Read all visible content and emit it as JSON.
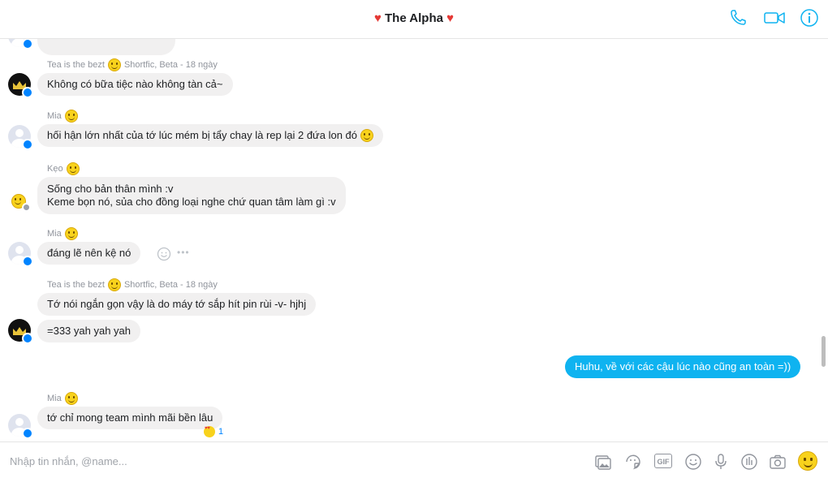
{
  "header": {
    "title": "The Alpha",
    "heart_left": "♥",
    "heart_right": "♥",
    "icons": [
      "phone-icon",
      "video-icon",
      "info-icon"
    ],
    "accent": "#0084ff"
  },
  "messages": [
    {
      "sender": "Tea is the bezt",
      "meta": "Shortfic, Beta - 18 ngày",
      "text": "Không có bữa tiệc nào không tàn cả~"
    },
    {
      "sender": "Mia",
      "text": "hối hận lớn nhất của tớ lúc mém bị tẩy chay là rep lại 2 đứa lon đó"
    },
    {
      "sender": "Kẹo",
      "line1": "Sống cho bản thân mình :v",
      "line2": "Keme bọn nó, sủa cho đồng loại nghe chứ quan tâm làm gì :v"
    },
    {
      "sender": "Mia",
      "text": "đáng lẽ nên kệ nó",
      "more": "•••"
    },
    {
      "sender": "Tea is the bezt",
      "meta": "Shortfic, Beta - 18 ngày",
      "text": "Tớ nói ngắn gọn vậy là do máy tớ sắp hít pin rùi -v- hjhj",
      "text2": "=333 yah yah yah"
    },
    {
      "sender": "me",
      "text": "Huhu, về với các cậu lúc nào cũng an toàn =))"
    },
    {
      "sender": "Mia",
      "text": "tớ chỉ mong team mình mãi bền lâu",
      "reaction_count": "1"
    }
  ],
  "composer": {
    "placeholder": "Nhập tin nhắn, @name...",
    "gif_label": "GIF",
    "icons": [
      "image-icon",
      "sticker-icon",
      "gif-icon",
      "emoji-icon",
      "microphone-icon",
      "poll-icon",
      "camera-icon",
      "like-emoji-icon"
    ]
  },
  "colors": {
    "outgoing_bubble": "#0fb3f0",
    "incoming_bubble": "#f1f0f0",
    "heart": "#e53935"
  }
}
